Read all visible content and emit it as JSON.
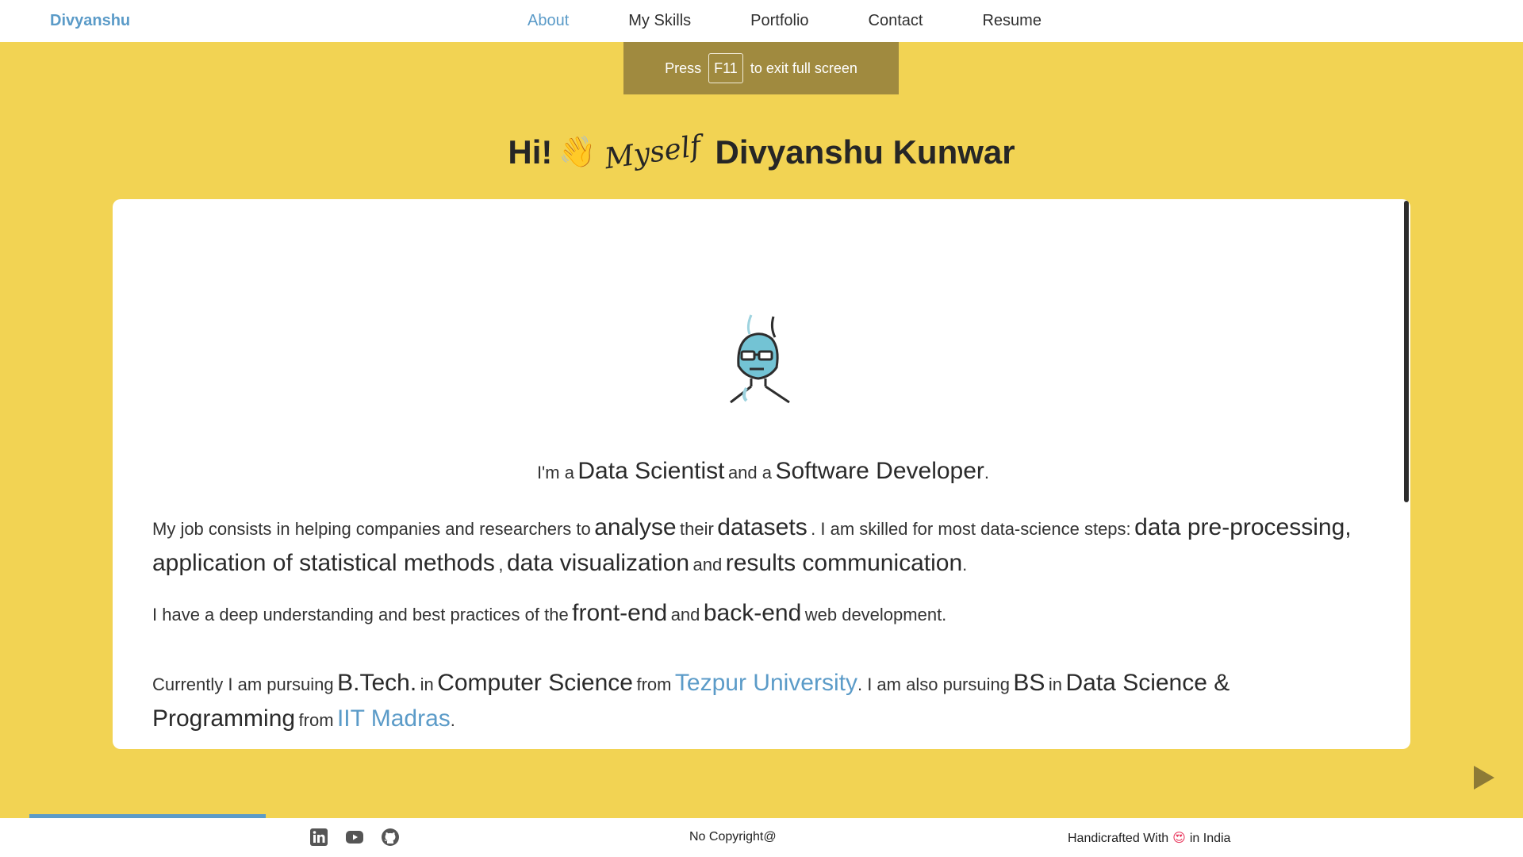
{
  "navbar": {
    "brand": "Divyanshu",
    "links": [
      "About",
      "My Skills",
      "Portfolio",
      "Contact",
      "Resume"
    ],
    "active": "About"
  },
  "fullscreen_toast": {
    "before": "Press",
    "key": "F11",
    "after": "to exit full screen"
  },
  "heading": {
    "hi": "Hi!",
    "wave": "👋",
    "myself": "Myself",
    "name": "Divyanshu Kunwar"
  },
  "card": {
    "avatar_icon": "developer-avatar-icon",
    "intro": {
      "t1": "I'm a",
      "role1": "Data Scientist",
      "t2": "and a",
      "role2": "Software Developer",
      "t3": "."
    },
    "job": {
      "t1": "My job consists in helping companies and researchers to",
      "w1": "analyse",
      "t2": "their",
      "w2": "datasets",
      "t3": ". I am skilled for most data-science steps:",
      "w3": "data pre-processing,",
      "w4": "application of statistical methods",
      "t4": ",",
      "w5": "data visualization",
      "t5": "and",
      "w6": "results communication",
      "t6": "."
    },
    "web": {
      "t1": "I have a deep understanding and best practices of the",
      "w1": "front-end",
      "t2": "and",
      "w2": "back-end",
      "t3": "web development."
    },
    "education": {
      "t1": "Currently I am pursuing",
      "w1": "B.Tech.",
      "t2": "in",
      "w2": "Computer Science",
      "t3": "from",
      "link1": "Tezpur University",
      "t4": ". I am also pursuing",
      "w3": "BS",
      "t5": "in",
      "w4": "Data Science &",
      "w5": "Programming",
      "t6": "from",
      "link2": "IIT Madras",
      "t7": "."
    }
  },
  "slide_progress": 0.155,
  "footer": {
    "social": [
      "linkedin-icon",
      "youtube-icon",
      "github-icon"
    ],
    "copyright": "No Copyright@",
    "handcrafted_before": "Handicrafted With",
    "heart": "😍",
    "handcrafted_after": "in India"
  },
  "colors": {
    "background": "#f2d353",
    "accent": "#5b9bc8",
    "toast": "#a08a3f"
  }
}
